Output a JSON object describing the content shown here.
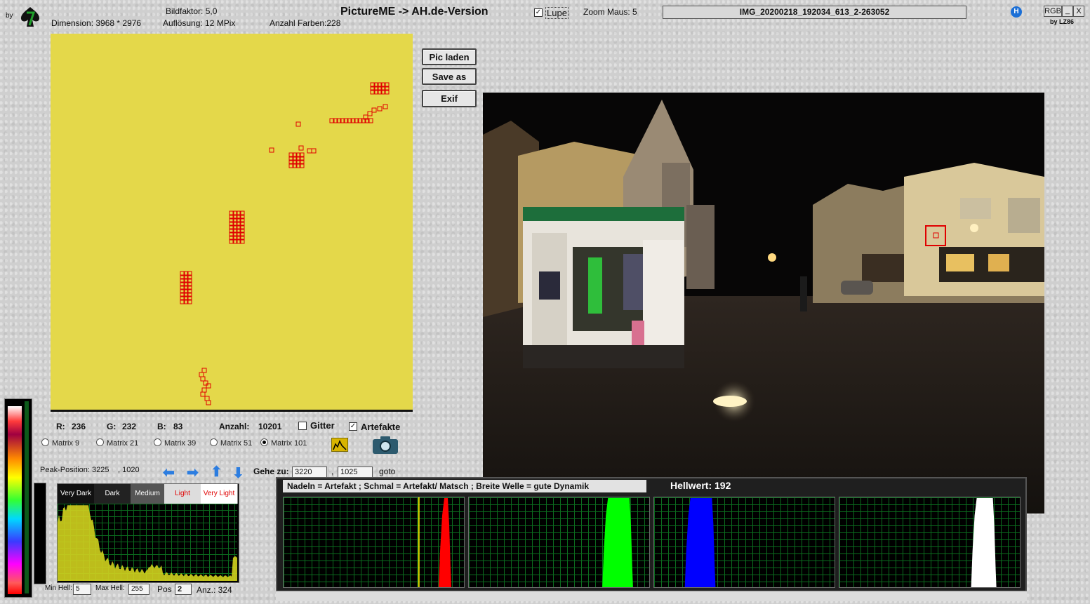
{
  "header": {
    "by_label": "by",
    "app_title": "PictureME -> AH.de-Version",
    "bildfaktor": "Bildfaktor: 5,0",
    "dimension": "Dimension:  3968 * 2976",
    "aufloesung": "Auflösung: 12 MPix",
    "anzahl_farben": "Anzahl Farben:228",
    "lupe_label": "Lupe",
    "lupe_checked": true,
    "zoom_maus": "Zoom Maus:  5",
    "filename": "IMG_20200218_192034_613_2-263052",
    "rgb_label": "RGB",
    "min_label": "_",
    "close_label": "X",
    "credit": "by LZ86",
    "help_icon": "H"
  },
  "buttons": {
    "pic_laden": "Pic laden",
    "save_as": "Save as",
    "exif": "Exif"
  },
  "pixel_info": {
    "r_label": "R:",
    "r_value": "236",
    "g_label": "G:",
    "g_value": "232",
    "b_label": "B:",
    "b_value": "83",
    "anzahl_label": "Anzahl:",
    "anzahl_value": "10201",
    "gitter_label": "Gitter",
    "gitter_checked": false,
    "artefakte_label": "Artefakte",
    "artefakte_checked": true
  },
  "matrix_options": [
    {
      "label": "Matrix 9",
      "selected": false
    },
    {
      "label": "Matrix 21",
      "selected": false
    },
    {
      "label": "Matrix 39",
      "selected": false
    },
    {
      "label": "Matrix 51",
      "selected": false
    },
    {
      "label": "Matrix 101",
      "selected": true
    }
  ],
  "peak": {
    "label": "Peak-Position:  3225",
    "y": ", 1020"
  },
  "goto": {
    "label": "Gehe zu:",
    "x": "3220",
    "sep": ",",
    "y": "1025",
    "button": "goto"
  },
  "luminance_panel": {
    "categories": [
      "Very Dark",
      "Dark",
      "Medium",
      "Light",
      "Very Light"
    ],
    "min_label": "Min Hell:",
    "min_value": "5",
    "max_label": "Max Hell:",
    "max_value": "255",
    "pos_label": "Pos",
    "pos_value": "2",
    "anz_label": "Anz.: 324"
  },
  "histogram_panel": {
    "hint": "Nadeln = Artefakt ; Schmal = Artefakt/ Matsch  ;  Breite Welle = gute Dynamik",
    "hellwert": "Hellwert: 192",
    "channels": [
      {
        "name": "red",
        "color": "#ff0000",
        "peak_from": 0.86,
        "peak_to": 0.93
      },
      {
        "name": "green",
        "color": "#00ff00",
        "peak_from": 0.74,
        "peak_to": 0.91
      },
      {
        "name": "blue",
        "color": "#0000ff",
        "peak_from": 0.17,
        "peak_to": 0.34
      },
      {
        "name": "white",
        "color": "#ffffff",
        "peak_from": 0.73,
        "peak_to": 0.87
      }
    ],
    "yellow_marker": 0.75
  },
  "colors": {
    "magnifier_yellow": "#e4d84a",
    "artifact_red": "#e00000"
  }
}
